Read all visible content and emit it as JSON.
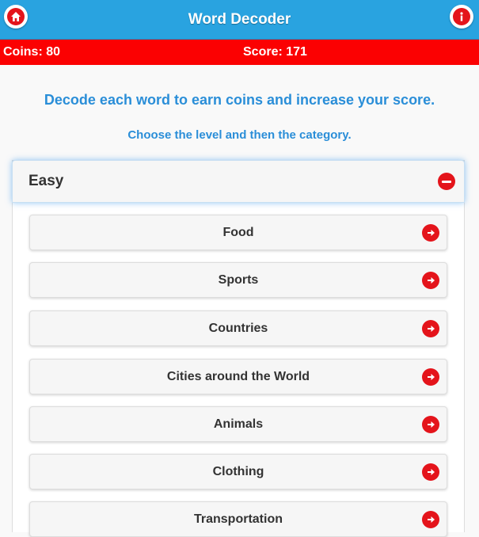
{
  "header": {
    "title": "Word Decoder",
    "home_icon": "home-icon",
    "info_icon": "info-icon"
  },
  "status": {
    "coins": "Coins: 80",
    "score": "Score: 171"
  },
  "intro": "Decode each word to earn coins and increase your score.",
  "instruction": "Choose the level and then the category.",
  "level": {
    "name": "Easy",
    "expanded": true,
    "categories": [
      "Food",
      "Sports",
      "Countries",
      "Cities around the World",
      "Animals",
      "Clothing",
      "Transportation"
    ]
  },
  "colors": {
    "header_bg": "#29a3e0",
    "status_bg": "#fb0102",
    "accent_text": "#2a8ed8",
    "icon_red": "#e4141b"
  }
}
